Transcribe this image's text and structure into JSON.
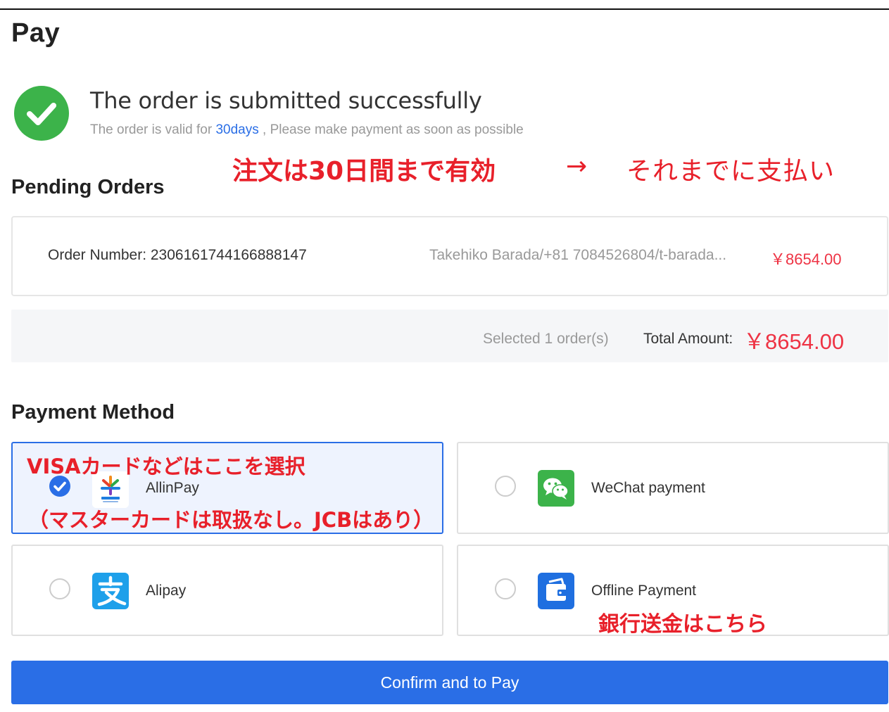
{
  "page": {
    "title": "Pay"
  },
  "success": {
    "title": "The order is submitted successfully",
    "sub_prefix": "The order is valid for ",
    "days": "30days",
    "sub_suffix": " , Please make payment as soon as possible"
  },
  "annotations": {
    "valid": "注文は30日間まで有効",
    "arrow": "→",
    "pay_before": "それまでに支払い",
    "visa": "VISAカードなどはここを選択",
    "master": "（マスターカードは取扱なし。JCBはあり）",
    "bank": "銀行送金はこちら"
  },
  "pending": {
    "heading": "Pending Orders",
    "order_number_label": "Order Number: 2306161744166888147",
    "contact": "Takehiko Barada/+81 7084526804/t-barada...",
    "price": "￥8654.00"
  },
  "summary": {
    "selected": "Selected 1 order(s)",
    "total_label": "Total Amount:",
    "total_value": "￥8654.00"
  },
  "payment": {
    "heading": "Payment Method",
    "methods": [
      {
        "label": "AllinPay",
        "icon": "allinpay-logo-icon",
        "selected": true
      },
      {
        "label": "WeChat payment",
        "icon": "wechat-icon",
        "selected": false
      },
      {
        "label": "Alipay",
        "icon": "alipay-icon",
        "selected": false
      },
      {
        "label": "Offline Payment",
        "icon": "wallet-icon",
        "selected": false
      }
    ]
  },
  "confirm": {
    "label": "Confirm and to Pay"
  },
  "colors": {
    "primary": "#2a6ee6",
    "price": "#ee3344",
    "success": "#3cb34a",
    "annotation": "#e8202a",
    "wechat": "#3cb34a",
    "alipay": "#1ea0ea",
    "offline": "#1f6fe0"
  }
}
